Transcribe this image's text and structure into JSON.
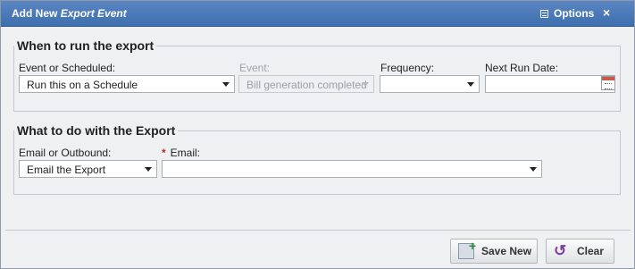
{
  "dialog": {
    "title_prefix": "Add New",
    "title_emph": "Export Event",
    "options_label": "Options",
    "close_glyph": "×"
  },
  "when": {
    "legend": "When to run the export",
    "event_or_scheduled": {
      "label": "Event or Scheduled:",
      "value": "Run this on a Schedule"
    },
    "event": {
      "label": "Event:",
      "value": "Bill generation completed",
      "disabled": true
    },
    "frequency": {
      "label": "Frequency:",
      "value": ""
    },
    "next_run_date": {
      "label": "Next Run Date:",
      "value": ""
    }
  },
  "what": {
    "legend": "What to do with the Export",
    "email_or_outbound": {
      "label": "Email or Outbound:",
      "value": "Email the Export"
    },
    "email": {
      "label": "Email:",
      "required_mark": "*",
      "value": ""
    }
  },
  "buttons": {
    "save_new": "Save New",
    "clear": "Clear"
  },
  "colors": {
    "titlebar": "#4a78b8",
    "required": "#c0262b"
  }
}
